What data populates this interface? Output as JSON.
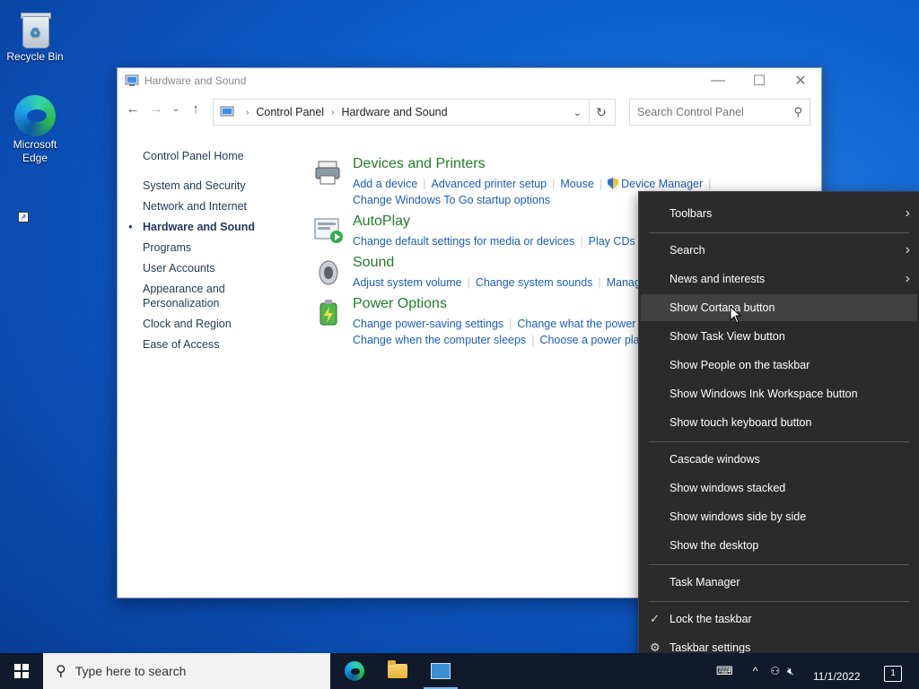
{
  "desktop": {
    "icons": [
      {
        "label": "Recycle Bin"
      },
      {
        "label": "Microsoft Edge"
      }
    ]
  },
  "window": {
    "title": "Hardware and Sound",
    "controls": {
      "minimize": "—",
      "maximize": "☐",
      "close": "✕"
    },
    "address": {
      "crumbs": [
        "Control Panel",
        "Hardware and Sound"
      ]
    },
    "search": {
      "placeholder": "Search Control Panel"
    },
    "left_nav": {
      "home": "Control Panel Home",
      "items": [
        "System and Security",
        "Network and Internet",
        "Hardware and Sound",
        "Programs",
        "User Accounts",
        "Appearance and Personalization",
        "Clock and Region",
        "Ease of Access"
      ],
      "active_index": 2
    },
    "categories": [
      {
        "title": "Devices and Printers",
        "links_line1": [
          "Add a device",
          "Advanced printer setup",
          "Mouse",
          "Device Manager"
        ],
        "links_line2": [
          "Change Windows To Go startup options"
        ]
      },
      {
        "title": "AutoPlay",
        "links_line1": [
          "Change default settings for media or devices",
          "Play CDs or other media automatically"
        ]
      },
      {
        "title": "Sound",
        "links_line1": [
          "Adjust system volume",
          "Change system sounds",
          "Manage audio devices"
        ]
      },
      {
        "title": "Power Options",
        "links_line1": [
          "Change power-saving settings",
          "Change what the power buttons do"
        ],
        "links_line2": [
          "Change when the computer sleeps",
          "Choose a power plan"
        ]
      }
    ]
  },
  "context_menu": {
    "items": [
      {
        "label": "Toolbars",
        "submenu": true
      },
      {
        "label": "Search",
        "submenu": true
      },
      {
        "label": "News and interests",
        "submenu": true
      },
      {
        "label": "Show Cortana button"
      },
      {
        "label": "Show Task View button"
      },
      {
        "label": "Show People on the taskbar"
      },
      {
        "label": "Show Windows Ink Workspace button"
      },
      {
        "label": "Show touch keyboard button"
      },
      {
        "label": "Cascade windows"
      },
      {
        "label": "Show windows stacked"
      },
      {
        "label": "Show windows side by side"
      },
      {
        "label": "Show the desktop"
      },
      {
        "label": "Task Manager"
      },
      {
        "label": "Lock the taskbar",
        "checked": true
      },
      {
        "label": "Taskbar settings",
        "icon": "gear-icon"
      }
    ],
    "hovered_index": 3
  },
  "taskbar": {
    "search_placeholder": "Type here to search",
    "date": "11/1/2022",
    "notification_count": "1"
  }
}
